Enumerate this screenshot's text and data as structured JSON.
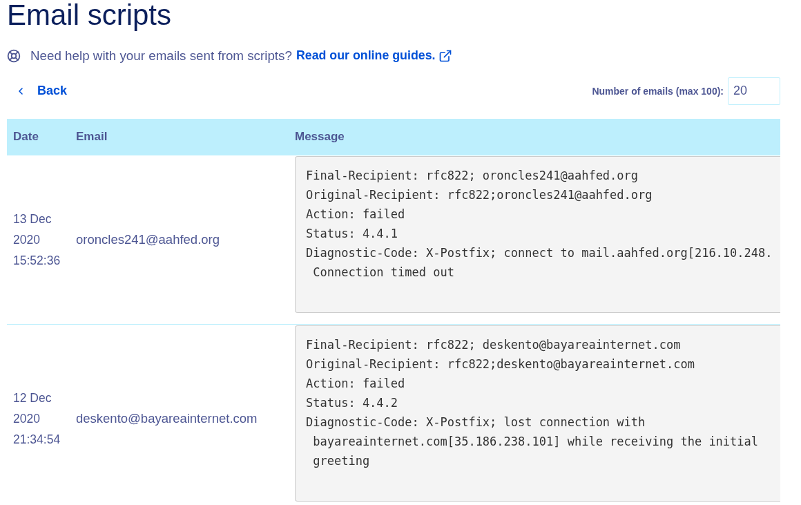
{
  "page": {
    "title": "Email scripts"
  },
  "help": {
    "text": "Need help with your emails sent from scripts?",
    "link": "Read our online guides."
  },
  "back_link": {
    "label": "Back"
  },
  "count_field": {
    "label": "Number of emails (max 100):",
    "value": "20"
  },
  "table": {
    "columns": [
      "Date",
      "Email",
      "Message"
    ],
    "rows": [
      {
        "date": "13 Dec 2020 15:52:36",
        "email": "oroncles241@aahfed.org",
        "message": [
          "Final-Recipient: rfc822; oroncles241@aahfed.org",
          "Original-Recipient: rfc822;oroncles241@aahfed.org",
          "Action: failed",
          "Status: 4.4.1",
          "Diagnostic-Code: X-Postfix; connect to mail.aahfed.org[216.10.248.",
          " Connection timed out"
        ]
      },
      {
        "date": "12 Dec 2020 21:34:54",
        "email": "deskento@bayareainternet.com",
        "message": [
          "Final-Recipient: rfc822; deskento@bayareainternet.com",
          "Original-Recipient: rfc822;deskento@bayareainternet.com",
          "Action: failed",
          "Status: 4.4.2",
          "Diagnostic-Code: X-Postfix; lost connection with",
          " bayareainternet.com[35.186.238.101] while receiving the initial",
          " greeting"
        ]
      }
    ]
  }
}
